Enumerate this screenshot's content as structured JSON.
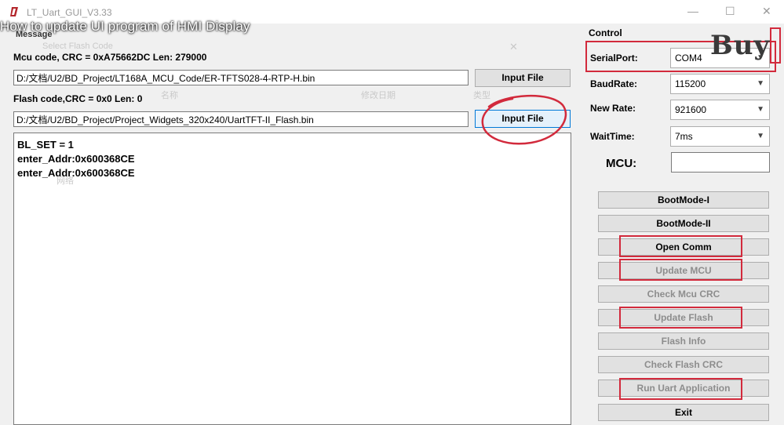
{
  "window": {
    "title": "LT_Uart_GUI_V3.33",
    "minimize_glyph": "—",
    "maximize_glyph": "☐",
    "close_glyph": "✕"
  },
  "video_overlay": {
    "title": "How to update UI program of HMI Display"
  },
  "ghost": {
    "group_label": "Message",
    "dialog_title": "Select Flash Code",
    "col_name": "名称",
    "col_date": "修改日期",
    "col_type": "类型",
    "net_item": "网络"
  },
  "message": {
    "mcu_code_label": "Mcu code, CRC = 0xA75662DC Len: 279000",
    "mcu_path": "D:/文档/U2/BD_Project/LT168A_MCU_Code/ER-TFTS028-4-RTP-H.bin",
    "mcu_input_button": "Input File",
    "flash_code_label": "Flash code,CRC = 0x0  Len: 0",
    "flash_path": "D:/文档/U2/BD_Project/Project_Widgets_320x240/UartTFT-II_Flash.bin",
    "flash_input_button": "Input File",
    "log_lines": [
      "BL_SET = 1",
      "enter_Addr:0x600368CE",
      "enter_Addr:0x600368CE"
    ]
  },
  "control": {
    "group_label": "Control",
    "serialport_label": "SerialPort:",
    "serialport_value": "COM4",
    "baudrate_label": "BaudRate:",
    "baudrate_value": "115200",
    "newrate_label": "New Rate:",
    "newrate_value": "921600",
    "waittime_label": "WaitTime:",
    "waittime_value": "7ms",
    "mcu_label": "MCU:",
    "mcu_value": ""
  },
  "buttons": {
    "bootmode_1": "BootMode-I",
    "bootmode_2": "BootMode-II",
    "open_comm": "Open Comm",
    "update_mcu": "Update MCU",
    "check_mcu_crc": "Check Mcu CRC",
    "update_flash": "Update Flash",
    "flash_info": "Flash Info",
    "check_flash_crc": "Check Flash CRC",
    "run_uart_application": "Run Uart Application",
    "exit": "Exit"
  },
  "watermark": {
    "text": "Buy"
  },
  "colors": {
    "annotation_red": "#d22a3c",
    "focus_blue": "#0078d7"
  }
}
